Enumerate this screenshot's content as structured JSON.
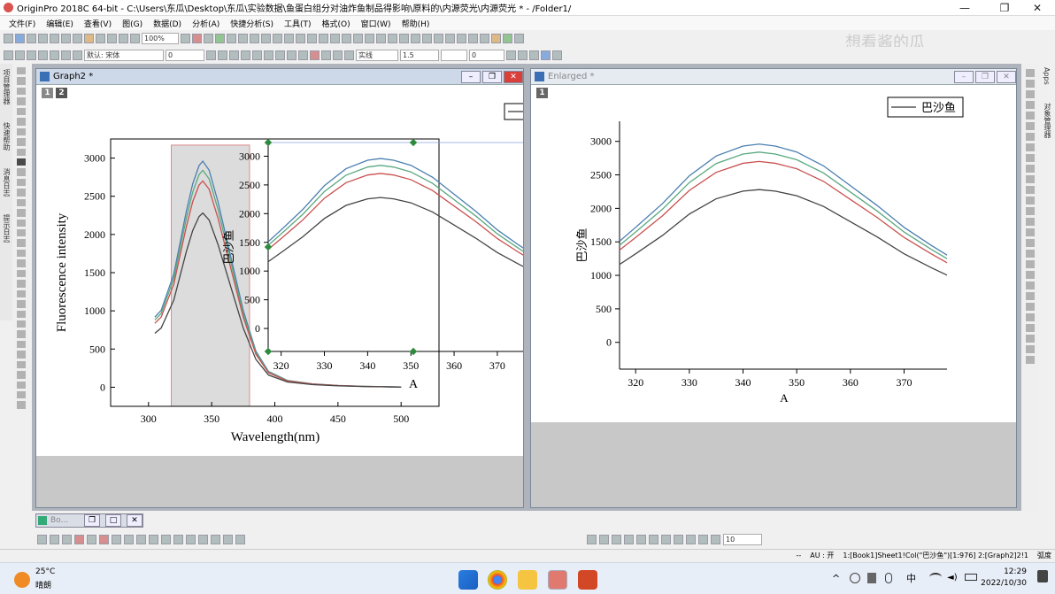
{
  "app": {
    "title": "OriginPro 2018C 64-bit - C:\\Users\\东瓜\\Desktop\\东瓜\\实验数据\\鱼蛋白组分对油炸鱼制品得影响\\原料的\\内源荧光\\内源荧光 * - /Folder1/",
    "menu": [
      "文件(F)",
      "编辑(E)",
      "查看(V)",
      "图(G)",
      "数据(D)",
      "分析(A)",
      "快捷分析(S)",
      "工具(T)",
      "格式(O)",
      "窗口(W)",
      "帮助(H)"
    ],
    "zoom": "100%",
    "font_name": "默认: 宋体",
    "font_size": "0",
    "line_width": "1.5",
    "line_style": "实线",
    "misc_value": "0",
    "bottom_combo": "10",
    "watermark": "想看酱的瓜"
  },
  "left_panel": {
    "labels": [
      "项目管理器",
      "快速帮助",
      "消息日志",
      "提示日志"
    ]
  },
  "right_panel": {
    "labels": [
      "Apps",
      "对象管理器"
    ]
  },
  "graph2": {
    "title": "Graph2 *",
    "layers": [
      "1",
      "2"
    ],
    "main": {
      "xlabel": "Wavelength(nm)",
      "ylabel": "Fluorescence intensity",
      "xticks": [
        "300",
        "350",
        "400",
        "450",
        "500"
      ],
      "yticks": [
        "0",
        "500",
        "1000",
        "1500",
        "2000",
        "2500",
        "3000"
      ]
    },
    "inset": {
      "xlabel": "A",
      "ylabel": "巴沙鱼",
      "xticks": [
        "320",
        "330",
        "340",
        "350",
        "360",
        "370"
      ],
      "yticks": [
        "0",
        "500",
        "1000",
        "1500",
        "2000",
        "2500",
        "3000"
      ]
    }
  },
  "enlarged": {
    "title": "Enlarged *",
    "layer": "1",
    "legend": "巴沙鱼",
    "xlabel": "A",
    "ylabel": "巴沙鱼",
    "xticks": [
      "320",
      "330",
      "340",
      "350",
      "360",
      "370"
    ],
    "yticks": [
      "0",
      "500",
      "1000",
      "1500",
      "2000",
      "2500",
      "3000"
    ]
  },
  "chart_data": [
    {
      "type": "line",
      "panel": "Graph2 main",
      "xlabel": "Wavelength(nm)",
      "ylabel": "Fluorescence intensity",
      "xlim": [
        270,
        530
      ],
      "ylim": [
        -250,
        3250
      ],
      "highlight_range": [
        318,
        380
      ],
      "series": [
        {
          "color": "#4a7fb0",
          "peak": 2960
        },
        {
          "color": "#5aa87f",
          "peak": 2840
        },
        {
          "color": "#c9504f",
          "peak": 2700
        },
        {
          "color": "#444444",
          "peak": 2280
        }
      ],
      "x": [
        305,
        310,
        320,
        330,
        335,
        340,
        343,
        348,
        355,
        365,
        375,
        385,
        395,
        410,
        430,
        450,
        470,
        490,
        500
      ],
      "shape": [
        0.31,
        0.34,
        0.5,
        0.78,
        0.9,
        0.98,
        1.0,
        0.96,
        0.82,
        0.58,
        0.34,
        0.16,
        0.07,
        0.03,
        0.015,
        0.008,
        0.004,
        0.002,
        0.001
      ]
    },
    {
      "type": "line",
      "panel": "inset and Enlarged",
      "xlabel": "A",
      "ylabel": "巴沙鱼",
      "xlim": [
        317,
        378
      ],
      "ylim": [
        -400,
        3300
      ],
      "x": [
        317,
        320,
        325,
        330,
        335,
        340,
        343,
        346,
        350,
        355,
        360,
        365,
        370,
        375,
        378
      ],
      "shape": [
        0.51,
        0.58,
        0.7,
        0.84,
        0.94,
        0.99,
        1.0,
        0.99,
        0.96,
        0.89,
        0.79,
        0.69,
        0.58,
        0.49,
        0.44
      ]
    }
  ],
  "statusbar": {
    "au": "AU : 开",
    "info": "1:[Book1]Sheet1!Col(\"巴沙鱼\")[1:976]  2:[Graph2]2!1",
    "mode": "弧度"
  },
  "taskbar": {
    "temp": "25°C",
    "weather": "晴朗",
    "ime": "中",
    "time": "12:29",
    "date": "2022/10/30"
  },
  "bottom_window": "Bo..."
}
